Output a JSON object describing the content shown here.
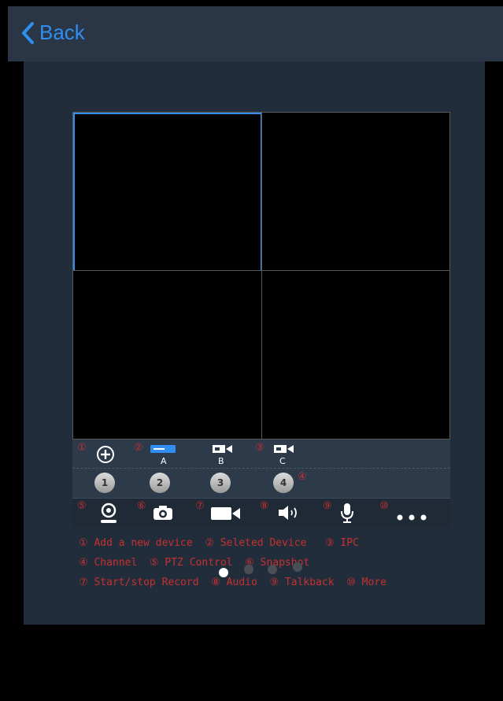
{
  "nav": {
    "back_label": "Back"
  },
  "toolbar": {
    "numbers": [
      "①",
      "②",
      "③",
      "④",
      "⑤",
      "⑥",
      "⑦",
      "⑧",
      "⑨",
      "⑩"
    ],
    "devices": [
      "A",
      "B",
      "C"
    ],
    "channels": [
      "1",
      "2",
      "3",
      "4"
    ]
  },
  "legend": {
    "lines": [
      "① Add a new device  ② Seleted Device   ③ IPC",
      "④ Channel  ⑤ PTZ Control  ⑥ Snapshot",
      "⑦ Start/stop Record  ⑧ Audio  ⑨ Talkback  ⑩ More"
    ]
  },
  "pager": {
    "pages": 4,
    "active_index": 0
  },
  "colors": {
    "accent": "#2f8ef0",
    "annotation": "#c63030",
    "nav_bg": "#2a3545",
    "panel_bg": "#222d3b"
  }
}
